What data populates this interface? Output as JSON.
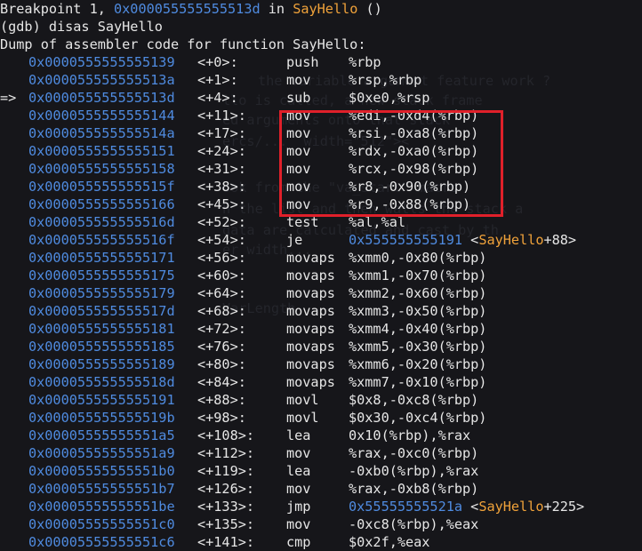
{
  "colors": {
    "background": "#16161a",
    "text": "#e6e6e6",
    "address": "#4f8be0",
    "function": "#f0a23a",
    "highlight_box": "#e0202a"
  },
  "header": {
    "bp_prefix": "Breakpoint 1, ",
    "bp_addr": "0x000055555555513d",
    "bp_in": " in ",
    "bp_func": "SayHello",
    "bp_args": " ()",
    "prompt": "(gdb) disas SayHello",
    "dump_title": "Dump of assembler code for function SayHello:"
  },
  "instructions": [
    {
      "arrow": "",
      "addr": "0x0000555555555139",
      "off": "<+0>:",
      "mn": "push",
      "op": "%rbp"
    },
    {
      "arrow": "",
      "addr": "0x000055555555513a",
      "off": "<+1>:",
      "mn": "mov",
      "op": "%rsp,%rbp"
    },
    {
      "arrow": "=>",
      "addr": "0x000055555555513d",
      "off": "<+4>:",
      "mn": "sub",
      "op": "$0xe0,%rsp"
    },
    {
      "arrow": "",
      "addr": "0x0000555555555144",
      "off": "<+11>:",
      "mn": "mov",
      "op": "%edi,-0xd4(%rbp)"
    },
    {
      "arrow": "",
      "addr": "0x000055555555514a",
      "off": "<+17>:",
      "mn": "mov",
      "op": "%rsi,-0xa8(%rbp)"
    },
    {
      "arrow": "",
      "addr": "0x0000555555555151",
      "off": "<+24>:",
      "mn": "mov",
      "op": "%rdx,-0xa0(%rbp)"
    },
    {
      "arrow": "",
      "addr": "0x0000555555555158",
      "off": "<+31>:",
      "mn": "mov",
      "op": "%rcx,-0x98(%rbp)"
    },
    {
      "arrow": "",
      "addr": "0x000055555555515f",
      "off": "<+38>:",
      "mn": "mov",
      "op": "%r8,-0x90(%rbp)"
    },
    {
      "arrow": "",
      "addr": "0x0000555555555166",
      "off": "<+45>:",
      "mn": "mov",
      "op": "%r9,-0x88(%rbp)"
    },
    {
      "arrow": "",
      "addr": "0x000055555555516d",
      "off": "<+52>:",
      "mn": "test",
      "op": "%al,%al"
    },
    {
      "arrow": "",
      "addr": "0x000055555555516f",
      "off": "<+54>:",
      "mn": "je",
      "op": "",
      "jaddr": "0x555555555191",
      "jfunc": "SayHello",
      "jofs": "+88"
    },
    {
      "arrow": "",
      "addr": "0x0000555555555171",
      "off": "<+56>:",
      "mn": "movaps",
      "op": "%xmm0,-0x80(%rbp)"
    },
    {
      "arrow": "",
      "addr": "0x0000555555555175",
      "off": "<+60>:",
      "mn": "movaps",
      "op": "%xmm1,-0x70(%rbp)"
    },
    {
      "arrow": "",
      "addr": "0x0000555555555179",
      "off": "<+64>:",
      "mn": "movaps",
      "op": "%xmm2,-0x60(%rbp)"
    },
    {
      "arrow": "",
      "addr": "0x000055555555517d",
      "off": "<+68>:",
      "mn": "movaps",
      "op": "%xmm3,-0x50(%rbp)"
    },
    {
      "arrow": "",
      "addr": "0x0000555555555181",
      "off": "<+72>:",
      "mn": "movaps",
      "op": "%xmm4,-0x40(%rbp)"
    },
    {
      "arrow": "",
      "addr": "0x0000555555555185",
      "off": "<+76>:",
      "mn": "movaps",
      "op": "%xmm5,-0x30(%rbp)"
    },
    {
      "arrow": "",
      "addr": "0x0000555555555189",
      "off": "<+80>:",
      "mn": "movaps",
      "op": "%xmm6,-0x20(%rbp)"
    },
    {
      "arrow": "",
      "addr": "0x000055555555518d",
      "off": "<+84>:",
      "mn": "movaps",
      "op": "%xmm7,-0x10(%rbp)"
    },
    {
      "arrow": "",
      "addr": "0x0000555555555191",
      "off": "<+88>:",
      "mn": "movl",
      "op": "$0x8,-0xc8(%rbp)"
    },
    {
      "arrow": "",
      "addr": "0x000055555555519b",
      "off": "<+98>:",
      "mn": "movl",
      "op": "$0x30,-0xc4(%rbp)"
    },
    {
      "arrow": "",
      "addr": "0x00005555555551a5",
      "off": "<+108>:",
      "mn": "lea",
      "op": "0x10(%rbp),%rax"
    },
    {
      "arrow": "",
      "addr": "0x00005555555551a9",
      "off": "<+112>:",
      "mn": "mov",
      "op": "%rax,-0xc0(%rbp)"
    },
    {
      "arrow": "",
      "addr": "0x00005555555551b0",
      "off": "<+119>:",
      "mn": "lea",
      "op": "-0xb0(%rbp),%rax"
    },
    {
      "arrow": "",
      "addr": "0x00005555555551b7",
      "off": "<+126>:",
      "mn": "mov",
      "op": "%rax,-0xb8(%rbp)"
    },
    {
      "arrow": "",
      "addr": "0x00005555555551be",
      "off": "<+133>:",
      "mn": "jmp",
      "op": "",
      "jaddr": "0x55555555521a",
      "jfunc": "SayHello",
      "jofs": "+225"
    },
    {
      "arrow": "",
      "addr": "0x00005555555551c0",
      "off": "<+135>:",
      "mn": "mov",
      "op": "-0xc8(%rbp),%eax"
    },
    {
      "arrow": "",
      "addr": "0x00005555555551c6",
      "off": "<+141>:",
      "mn": "cmp",
      "op": "$0x2f,%eax"
    }
  ]
}
